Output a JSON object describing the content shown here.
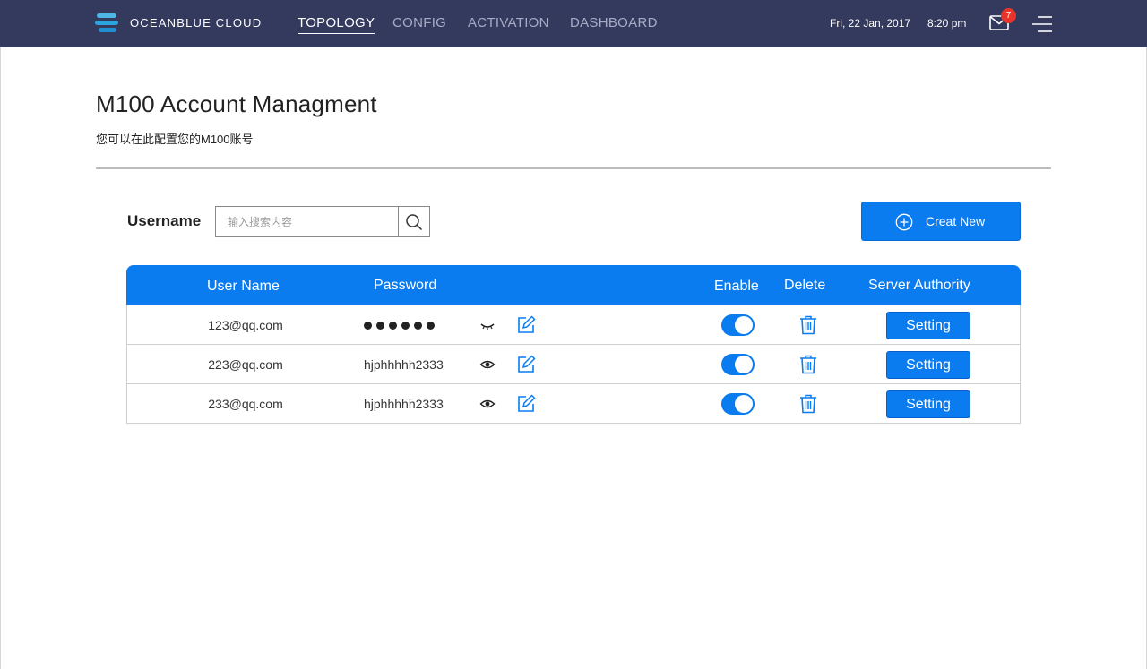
{
  "header": {
    "brand": "OCEANBLUE CLOUD",
    "nav": [
      {
        "label": "TOPOLOGY",
        "active": true
      },
      {
        "label": "CONFIG",
        "active": false
      },
      {
        "label": "ACTIVATION",
        "active": false
      },
      {
        "label": "DASHBOARD",
        "active": false
      }
    ],
    "date": "Fri, 22 Jan, 2017",
    "time": "8:20 pm",
    "mail_badge": "7"
  },
  "page": {
    "title": "M100 Account Managment",
    "subtitle": "您可以在此配置您的M100账号"
  },
  "search": {
    "label": "Username",
    "placeholder": "输入搜索内容",
    "value": ""
  },
  "create_button": {
    "label": "Creat New"
  },
  "table": {
    "headers": {
      "user_name": "User Name",
      "password": "Password",
      "enable": "Enable",
      "delete": "Delete",
      "server_authority": "Server Authority"
    },
    "rows": [
      {
        "user": "123@qq.com",
        "password": "",
        "password_hidden": true,
        "enabled": true,
        "setting_label": "Setting"
      },
      {
        "user": "223@qq.com",
        "password": "hjphhhhh2333",
        "password_hidden": false,
        "enabled": true,
        "setting_label": "Setting"
      },
      {
        "user": "233@qq.com",
        "password": "hjphhhhh2333",
        "password_hidden": false,
        "enabled": true,
        "setting_label": "Setting"
      }
    ]
  },
  "colors": {
    "topbar": "#343a5e",
    "accent": "#0a7cf0",
    "badge": "#e8342a"
  },
  "icons": [
    "logo-icon",
    "mail-icon",
    "menu-icon",
    "search-icon",
    "plus-circle-icon",
    "eye-closed-icon",
    "eye-icon",
    "edit-icon",
    "trash-icon"
  ]
}
